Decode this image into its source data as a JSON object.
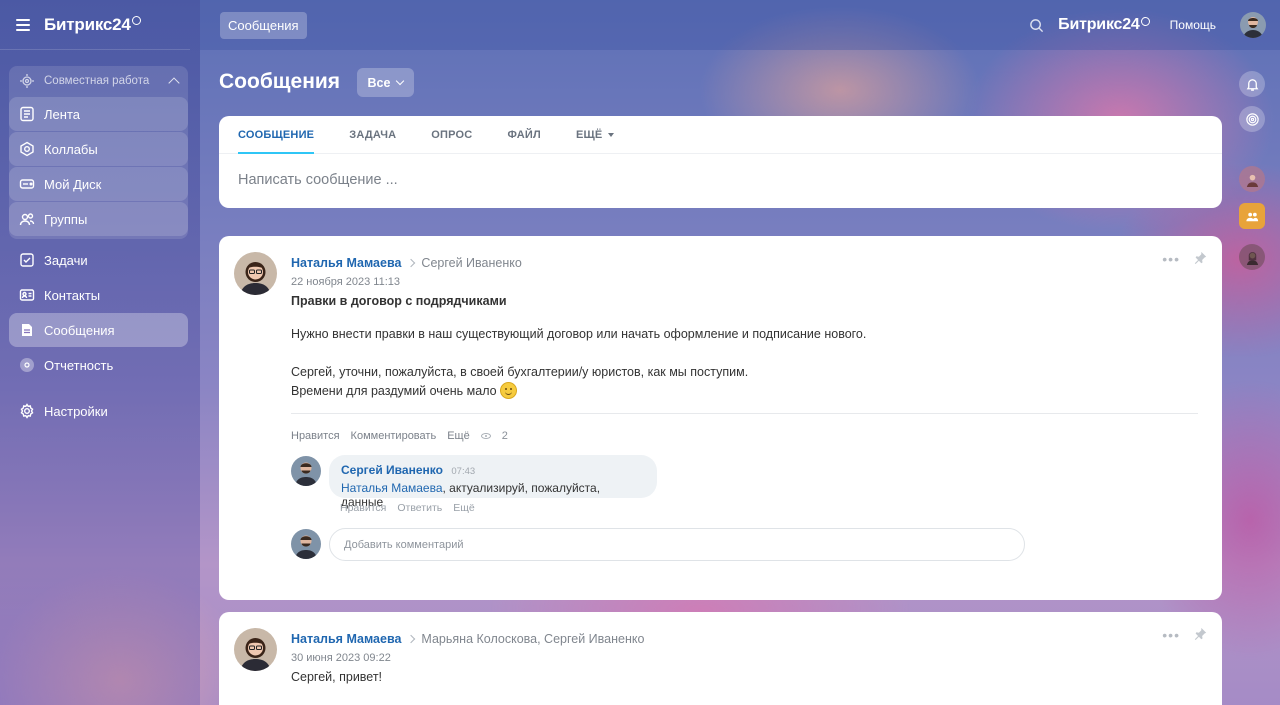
{
  "app": {
    "logo_text": "Битрикс24",
    "top_chip": "Сообщения",
    "help_label": "Помощь"
  },
  "sidebar": {
    "group_title": "Совместная работа",
    "group_items": [
      {
        "label": "Лента",
        "icon": "feed-icon"
      },
      {
        "label": "Коллабы",
        "icon": "collab-icon"
      },
      {
        "label": "Мой Диск",
        "icon": "disk-icon"
      },
      {
        "label": "Группы",
        "icon": "groups-icon"
      }
    ],
    "items": [
      {
        "label": "Задачи",
        "icon": "tasks-icon"
      },
      {
        "label": "Контакты",
        "icon": "contacts-icon"
      },
      {
        "label": "Сообщения",
        "icon": "messages-icon"
      },
      {
        "label": "Отчетность",
        "icon": "reports-icon"
      },
      {
        "label": "Настройки",
        "icon": "settings-icon"
      }
    ]
  },
  "main": {
    "title": "Сообщения",
    "filter_label": "Все",
    "composer": {
      "tabs": [
        "СООБЩЕНИЕ",
        "ЗАДАЧА",
        "ОПРОС",
        "ФАЙЛ",
        "ЕЩЁ"
      ],
      "placeholder": "Написать сообщение ..."
    },
    "posts": [
      {
        "author": "Наталья Мамаева",
        "recipients": "Сергей Иваненко",
        "date": "22 ноября 2023 11:13",
        "title": "Правки в договор с подрядчиками",
        "body": [
          "Нужно внести правки в наш существующий договор или начать оформление и подписание нового.",
          "Сергей, уточни, пожалуйста, в своей бухгалтерии/у юристов, как мы поступим.",
          "Времени для раздумий очень мало"
        ],
        "actions": {
          "like": "Нравится",
          "comment": "Комментировать",
          "more": "Ещё",
          "views": "2"
        },
        "comment": {
          "author": "Сергей Иваненко",
          "time": "07:43",
          "mention": "Наталья Мамаева",
          "text": ", актуализируй, пожалуйста, данные",
          "actions": {
            "like": "Нравится",
            "reply": "Ответить",
            "more": "Ещё"
          }
        },
        "add_comment_placeholder": "Добавить комментарий"
      },
      {
        "author": "Наталья Мамаева",
        "recipients": "Марьяна Колоскова, Сергей Иваненко",
        "date": "30 июня 2023 09:22",
        "title": "Сергей, привет!"
      }
    ]
  },
  "colors": {
    "link": "#2067b0",
    "tab_underline": "#2fc6f6"
  }
}
